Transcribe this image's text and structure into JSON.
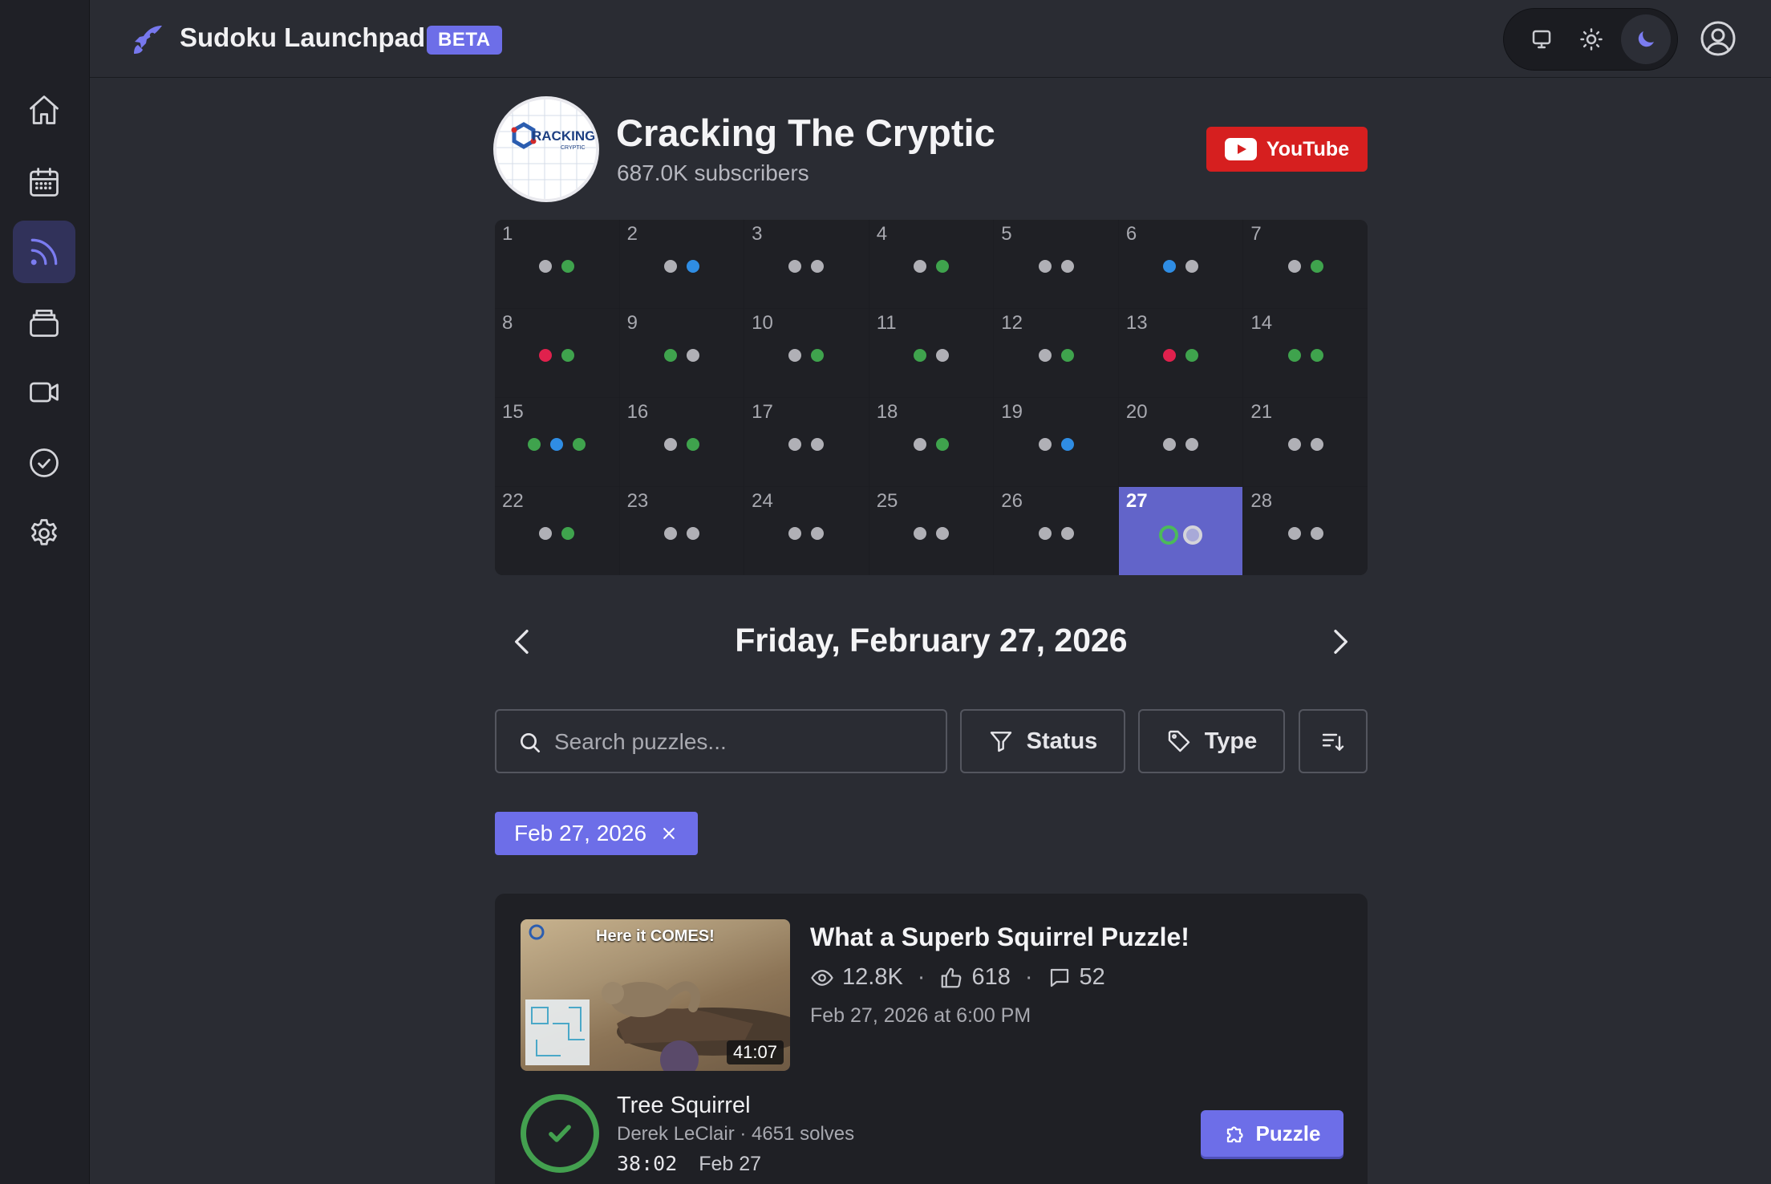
{
  "app": {
    "title": "Sudoku Launchpad",
    "badge": "BETA"
  },
  "sidebar": {
    "items": [
      {
        "name": "home",
        "icon": "home-icon"
      },
      {
        "name": "calendar",
        "icon": "calendar-icon"
      },
      {
        "name": "feed",
        "icon": "rss-icon",
        "active": true
      },
      {
        "name": "collections",
        "icon": "stack-icon"
      },
      {
        "name": "videos",
        "icon": "video-icon"
      },
      {
        "name": "solved",
        "icon": "check-circle-icon"
      },
      {
        "name": "settings",
        "icon": "gear-icon"
      }
    ]
  },
  "theme": {
    "options": [
      "system",
      "light",
      "dark"
    ],
    "selected": "dark"
  },
  "channel": {
    "name": "Cracking The Cryptic",
    "subscribers": "687.0K subscribers",
    "youtube_label": "YouTube",
    "avatar_text": "RACKING",
    "avatar_subtext": "CRYPTIC"
  },
  "calendar": {
    "selected_day": 27,
    "days": [
      {
        "d": "1",
        "dots": [
          "gray",
          "green"
        ]
      },
      {
        "d": "2",
        "dots": [
          "gray",
          "blue"
        ]
      },
      {
        "d": "3",
        "dots": [
          "gray",
          "gray"
        ]
      },
      {
        "d": "4",
        "dots": [
          "gray",
          "green"
        ]
      },
      {
        "d": "5",
        "dots": [
          "gray",
          "gray"
        ]
      },
      {
        "d": "6",
        "dots": [
          "blue",
          "gray"
        ]
      },
      {
        "d": "7",
        "dots": [
          "gray",
          "green"
        ]
      },
      {
        "d": "8",
        "dots": [
          "red",
          "green"
        ]
      },
      {
        "d": "9",
        "dots": [
          "green",
          "gray"
        ]
      },
      {
        "d": "10",
        "dots": [
          "gray",
          "green"
        ]
      },
      {
        "d": "11",
        "dots": [
          "green",
          "gray"
        ]
      },
      {
        "d": "12",
        "dots": [
          "gray",
          "green"
        ]
      },
      {
        "d": "13",
        "dots": [
          "red",
          "green"
        ]
      },
      {
        "d": "14",
        "dots": [
          "green",
          "green"
        ]
      },
      {
        "d": "15",
        "dots": [
          "green",
          "blue",
          "green"
        ]
      },
      {
        "d": "16",
        "dots": [
          "gray",
          "green"
        ]
      },
      {
        "d": "17",
        "dots": [
          "gray",
          "gray"
        ]
      },
      {
        "d": "18",
        "dots": [
          "gray",
          "green"
        ]
      },
      {
        "d": "19",
        "dots": [
          "gray",
          "blue"
        ]
      },
      {
        "d": "20",
        "dots": [
          "gray",
          "gray"
        ]
      },
      {
        "d": "21",
        "dots": [
          "gray",
          "gray"
        ]
      },
      {
        "d": "22",
        "dots": [
          "gray",
          "green"
        ]
      },
      {
        "d": "23",
        "dots": [
          "gray",
          "gray"
        ]
      },
      {
        "d": "24",
        "dots": [
          "gray",
          "gray"
        ]
      },
      {
        "d": "25",
        "dots": [
          "gray",
          "gray"
        ]
      },
      {
        "d": "26",
        "dots": [
          "gray",
          "gray"
        ]
      },
      {
        "d": "27",
        "dots": [
          "ring-green",
          "ring-gray"
        ]
      },
      {
        "d": "28",
        "dots": [
          "gray",
          "gray"
        ]
      }
    ]
  },
  "date_nav": {
    "title": "Friday, February 27, 2026"
  },
  "filters": {
    "search_placeholder": "Search puzzles...",
    "status_label": "Status",
    "type_label": "Type",
    "active_chip": "Feb 27, 2026"
  },
  "video": {
    "title": "What a Superb Squirrel Puzzle!",
    "views": "12.8K",
    "likes": "618",
    "comments": "52",
    "published": "Feb 27, 2026 at 6:00 PM",
    "duration": "41:07",
    "thumb_text": "Here it COMES!"
  },
  "puzzle": {
    "name": "Tree Squirrel",
    "author": "Derek LeClair",
    "solves": "· 4651 solves",
    "time": "38:02",
    "date": "Feb 27",
    "button_label": "Puzzle"
  },
  "colors": {
    "accent": "#6d6ee8",
    "youtube": "#d61f1f",
    "green": "#3fa34d",
    "blue": "#2f8de4",
    "red": "#e0214d",
    "gray": "#b0b0b6"
  }
}
